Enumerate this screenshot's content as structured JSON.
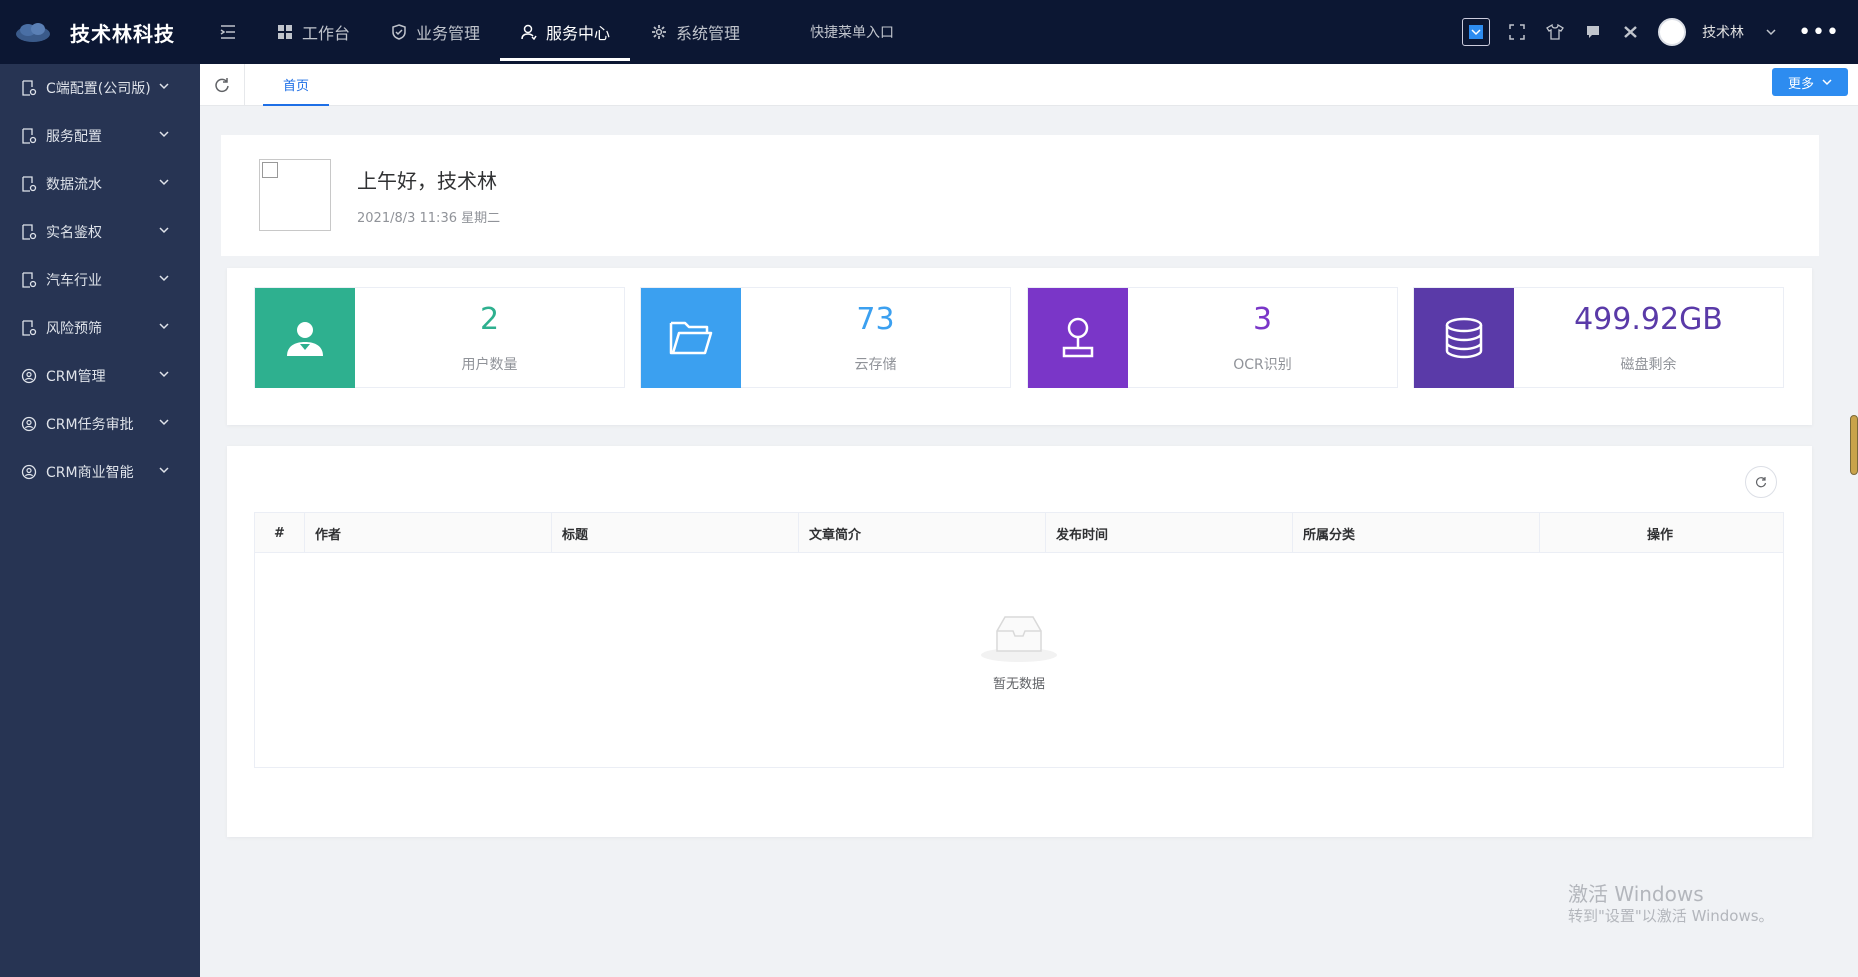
{
  "app": {
    "title": "技术林科技"
  },
  "topnav": {
    "items": [
      {
        "label": "工作台",
        "icon": "dashboard-icon",
        "active": false
      },
      {
        "label": "业务管理",
        "icon": "shield-icon",
        "active": false
      },
      {
        "label": "服务中心",
        "icon": "user-service-icon",
        "active": true
      },
      {
        "label": "系统管理",
        "icon": "gear-icon",
        "active": false
      }
    ],
    "quick_entry": "快捷菜单入口"
  },
  "user": {
    "name": "技术林"
  },
  "sidebar": {
    "items": [
      {
        "label": "C端配置(公司版)",
        "icon": "document-gear-icon"
      },
      {
        "label": "服务配置",
        "icon": "document-gear-icon"
      },
      {
        "label": "数据流水",
        "icon": "document-gear-icon"
      },
      {
        "label": "实名鉴权",
        "icon": "document-gear-icon"
      },
      {
        "label": "汽车行业",
        "icon": "document-gear-icon"
      },
      {
        "label": "风险预筛",
        "icon": "document-gear-icon"
      },
      {
        "label": "CRM管理",
        "icon": "crm-icon"
      },
      {
        "label": "CRM任务审批",
        "icon": "crm-icon"
      },
      {
        "label": "CRM商业智能",
        "icon": "crm-icon"
      }
    ]
  },
  "tabs": {
    "home": "首页",
    "more": "更多"
  },
  "welcome": {
    "greeting": "上午好，技术林",
    "datetime": "2021/8/3 11:36 星期二"
  },
  "stats": [
    {
      "value": "2",
      "label": "用户数量",
      "color": "#2eb08f",
      "icon": "user-icon"
    },
    {
      "value": "73",
      "label": "云存储",
      "color": "#3ba0f0",
      "icon": "folder-icon"
    },
    {
      "value": "3",
      "label": "OCR识别",
      "color": "#7a36c8",
      "icon": "joystick-icon"
    },
    {
      "value": "499.92GB",
      "label": "磁盘剩余",
      "color": "#5a3aa8",
      "icon": "database-icon"
    }
  ],
  "table": {
    "columns": [
      "#",
      "作者",
      "标题",
      "文章简介",
      "发布时间",
      "所属分类",
      "操作"
    ],
    "empty_text": "暂无数据"
  },
  "watermark": {
    "line1": "激活 Windows",
    "line2": "转到\"设置\"以激活 Windows。"
  }
}
